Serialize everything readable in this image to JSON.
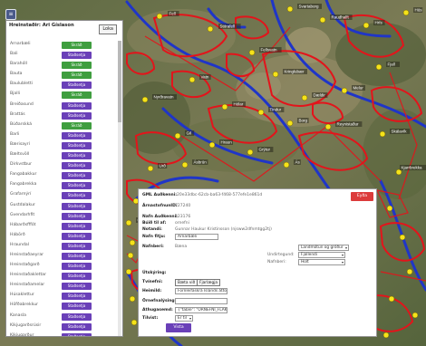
{
  "colors": {
    "green_button": "#3f9e3f",
    "purple_button": "#6a40b8",
    "red_button": "#dc3b3b",
    "map_red": "#e3141b",
    "map_blue": "#1f35c8",
    "map_marker": "#f5e31a"
  },
  "map": {
    "toggle_icon": "layers-icon",
    "labels": [
      "Fell",
      "Stórafell",
      "Fellsvatn",
      "Svartaborg",
      "Raudhalft",
      "Hrís",
      "Hús",
      "Vatn",
      "Kringlubær",
      "Dældir",
      "Melur",
      "Fjall",
      "Nyrðravatn",
      "Hólar",
      "Tindur",
      "Borg",
      "Reynistaður",
      "Skálavík",
      "Gil",
      "Hraun",
      "Grýtur",
      "Ás",
      "Urð",
      "Ásbrún",
      "Kjarrbrekka",
      "Holt",
      "Gryfjur",
      "Hvammur",
      "Hólmi",
      "Hæðir"
    ]
  },
  "panel": {
    "title": "Hreinstaðir: Ari Gíslason",
    "close_label": "Loka",
    "rows": [
      {
        "name": "Arnarbæli",
        "button": "Skráð",
        "status": "green"
      },
      {
        "name": "Bali",
        "button": "Staðsetja",
        "status": "purple"
      },
      {
        "name": "Barahóll",
        "button": "Skráð",
        "status": "green"
      },
      {
        "name": "Bauta",
        "button": "Skráð",
        "status": "green"
      },
      {
        "name": "Baulubletti",
        "button": "Staðsetja",
        "status": "purple"
      },
      {
        "name": "Bjalli",
        "button": "Skráð",
        "status": "green"
      },
      {
        "name": "Breiðasund",
        "button": "Staðsetja",
        "status": "purple"
      },
      {
        "name": "Brattás",
        "button": "Staðsetja",
        "status": "purple"
      },
      {
        "name": "Búðarskká",
        "button": "Skráð",
        "status": "green"
      },
      {
        "name": "Barli",
        "button": "Staðsetja",
        "status": "purple"
      },
      {
        "name": "Bærisayrí",
        "button": "Staðsetja",
        "status": "purple"
      },
      {
        "name": "Bæltsvöll",
        "button": "Staðsetja",
        "status": "purple"
      },
      {
        "name": "Dirkvstbur",
        "button": "Staðsetja",
        "status": "purple"
      },
      {
        "name": "Fangabakkur",
        "button": "Staðsetja",
        "status": "purple"
      },
      {
        "name": "Fangabrekka",
        "button": "Staðsetja",
        "status": "purple"
      },
      {
        "name": "Grafarnýrí",
        "button": "Staðsetja",
        "status": "purple"
      },
      {
        "name": "Gustdalakur",
        "button": "Staðsetja",
        "status": "purple"
      },
      {
        "name": "Gvendarhfit",
        "button": "Staðsetja",
        "status": "purple"
      },
      {
        "name": "Hábarðsfffót",
        "button": "Staðsetja",
        "status": "purple"
      },
      {
        "name": "Hábörð",
        "button": "Staðsetja",
        "status": "purple"
      },
      {
        "name": "Hraundal",
        "button": "Staðsetja",
        "status": "purple"
      },
      {
        "name": "Hreinstaðaeyrar",
        "button": "Staðsetja",
        "status": "purple"
      },
      {
        "name": "Hreinstaðgarð",
        "button": "Staðsetja",
        "status": "purple"
      },
      {
        "name": "Hreinstaðaklettar",
        "button": "Staðsetja",
        "status": "purple"
      },
      {
        "name": "Hreinstaðamelar",
        "button": "Staðsetja",
        "status": "purple"
      },
      {
        "name": "Húsaklettur",
        "button": "Staðsetja",
        "status": "purple"
      },
      {
        "name": "Höfðabrekkur",
        "button": "Staðsetja",
        "status": "purple"
      },
      {
        "name": "Kanasla",
        "button": "Staðsetja",
        "status": "purple"
      },
      {
        "name": "Kíkjugarðsrúsir",
        "button": "Staðsetja",
        "status": "purple"
      },
      {
        "name": "Kíkjugarður",
        "button": "Staðsetja",
        "status": "purple"
      },
      {
        "name": "Kílyfsskóli",
        "button": "Staðsetja",
        "status": "purple"
      }
    ]
  },
  "dialog": {
    "gml_label": "GML Auðkenni:",
    "gml_value": "20e33dbc-62cb-ba63-f468-577efe1e861d",
    "delete_label": "Eyða",
    "arnastofnun_label": "ÁrnastofnunID:",
    "arnastofnun_value": "727240",
    "nafn_label": "Nafn Auðkenni:",
    "nafn_value": "123176",
    "buid_label": "Búið til af:",
    "buid_value": "ornefni",
    "notandi_label": "Notandi:",
    "notandi_value": "Gunnar Haukur Kristinsson (njsww2dfnmtgg2tj)",
    "nafn_fitju_label": "Nafn fitju:",
    "nafn_fitju_value": "Arnarbæli",
    "nafnberi_label": "Nafnberi:",
    "nafnberi_value": "Bæna",
    "yfirflokkur_value": "Landmótun og gróður",
    "undirtegund_label": "Undirtegund:",
    "undirtegund_value": "Fjallendi",
    "nafnberi2_label": "Nafnberi:",
    "nafnberi2_value": "Holt",
    "utskyring_label": "Útskýring:",
    "tvinefni_label": "Tvínefni:",
    "baeta_label": "Bæta við",
    "fjarlaegja_label": "Fjarlægja",
    "heimild_label": "Heimild:",
    "heimild_value": "Fornleifaskrá Íslands áttob",
    "ornefnalysing_label": "Örnefnalýsing:",
    "athugasemd_label": "Athugasemd:",
    "athugasemd_value": "{\"table\": \"ORNEFNI_FLAK",
    "tilvist_label": "Tilvist:",
    "tilvist_value": "Er til",
    "vista_label": "Vista"
  }
}
